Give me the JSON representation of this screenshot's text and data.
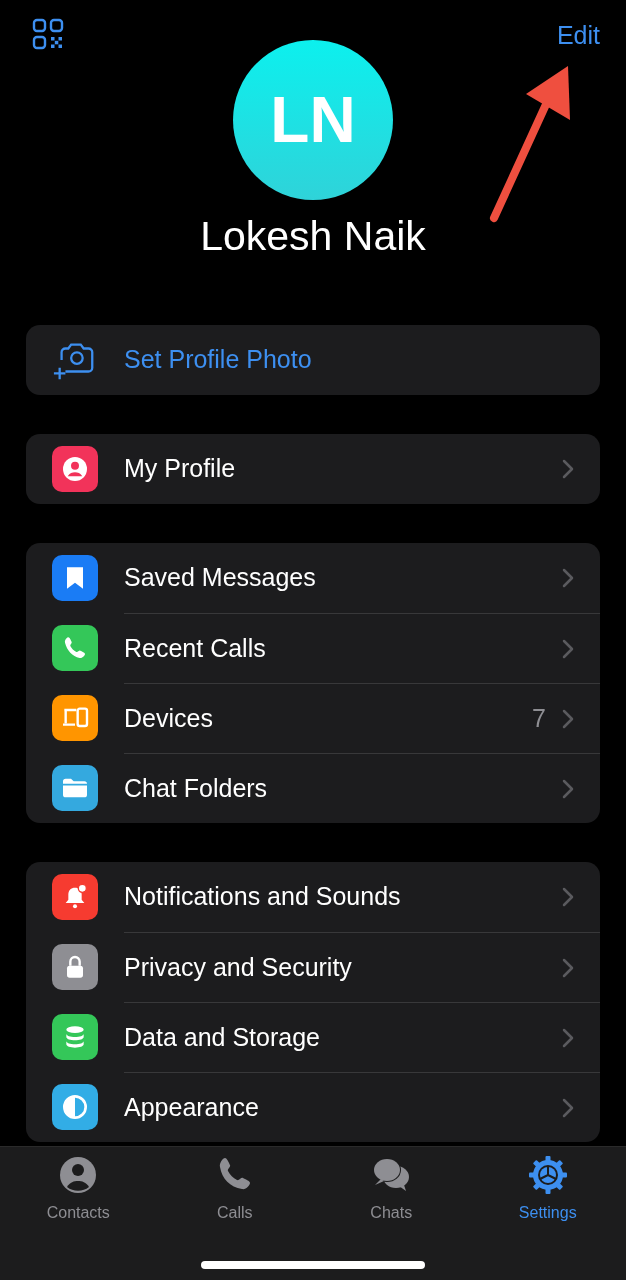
{
  "header": {
    "edit": "Edit"
  },
  "profile": {
    "initials": "LN",
    "name": "Lokesh Naik"
  },
  "set_photo": {
    "label": "Set Profile Photo"
  },
  "groups": [
    [
      {
        "label": "My Profile",
        "color": "#f2335a"
      }
    ],
    [
      {
        "label": "Saved Messages",
        "color": "#1a7cf5"
      },
      {
        "label": "Recent Calls",
        "color": "#34c759"
      },
      {
        "label": "Devices",
        "color": "#ff9500",
        "count": "7"
      },
      {
        "label": "Chat Folders",
        "color": "#34a9df"
      }
    ],
    [
      {
        "label": "Notifications and Sounds",
        "color": "#f63b30"
      },
      {
        "label": "Privacy and Security",
        "color": "#8e8e93"
      },
      {
        "label": "Data and Storage",
        "color": "#34c759"
      },
      {
        "label": "Appearance",
        "color": "#32ade6"
      }
    ]
  ],
  "tabs": [
    {
      "label": "Contacts",
      "selected": false
    },
    {
      "label": "Calls",
      "selected": false
    },
    {
      "label": "Chats",
      "selected": false
    },
    {
      "label": "Settings",
      "selected": true
    }
  ]
}
